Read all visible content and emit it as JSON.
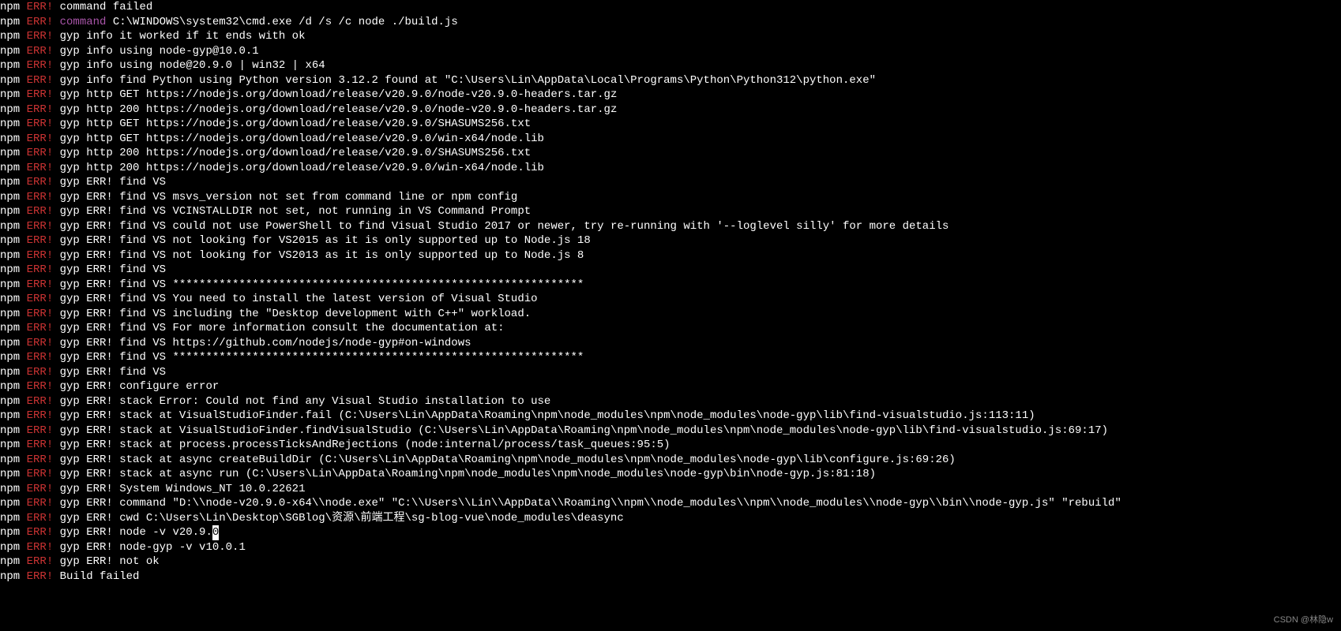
{
  "prefix": "npm",
  "errLabel": "ERR!",
  "commandLabel": "command",
  "lines": [
    {
      "type": "err",
      "text": "command failed"
    },
    {
      "type": "command",
      "text": "C:\\WINDOWS\\system32\\cmd.exe /d /s /c node ./build.js"
    },
    {
      "type": "err",
      "text": "gyp info it worked if it ends with ok"
    },
    {
      "type": "err",
      "text": "gyp info using node-gyp@10.0.1"
    },
    {
      "type": "err",
      "text": "gyp info using node@20.9.0 | win32 | x64"
    },
    {
      "type": "err",
      "text": "gyp info find Python using Python version 3.12.2 found at \"C:\\Users\\Lin\\AppData\\Local\\Programs\\Python\\Python312\\python.exe\""
    },
    {
      "type": "err",
      "text": "gyp http GET https://nodejs.org/download/release/v20.9.0/node-v20.9.0-headers.tar.gz"
    },
    {
      "type": "err",
      "text": "gyp http 200 https://nodejs.org/download/release/v20.9.0/node-v20.9.0-headers.tar.gz"
    },
    {
      "type": "err",
      "text": "gyp http GET https://nodejs.org/download/release/v20.9.0/SHASUMS256.txt"
    },
    {
      "type": "err",
      "text": "gyp http GET https://nodejs.org/download/release/v20.9.0/win-x64/node.lib"
    },
    {
      "type": "err",
      "text": "gyp http 200 https://nodejs.org/download/release/v20.9.0/SHASUMS256.txt"
    },
    {
      "type": "err",
      "text": "gyp http 200 https://nodejs.org/download/release/v20.9.0/win-x64/node.lib"
    },
    {
      "type": "err",
      "text": "gyp ERR! find VS"
    },
    {
      "type": "err",
      "text": "gyp ERR! find VS msvs_version not set from command line or npm config"
    },
    {
      "type": "err",
      "text": "gyp ERR! find VS VCINSTALLDIR not set, not running in VS Command Prompt"
    },
    {
      "type": "err",
      "text": "gyp ERR! find VS could not use PowerShell to find Visual Studio 2017 or newer, try re-running with '--loglevel silly' for more details"
    },
    {
      "type": "err",
      "text": "gyp ERR! find VS not looking for VS2015 as it is only supported up to Node.js 18"
    },
    {
      "type": "err",
      "text": "gyp ERR! find VS not looking for VS2013 as it is only supported up to Node.js 8"
    },
    {
      "type": "err",
      "text": "gyp ERR! find VS"
    },
    {
      "type": "err",
      "text": "gyp ERR! find VS **************************************************************"
    },
    {
      "type": "err",
      "text": "gyp ERR! find VS You need to install the latest version of Visual Studio"
    },
    {
      "type": "err",
      "text": "gyp ERR! find VS including the \"Desktop development with C++\" workload."
    },
    {
      "type": "err",
      "text": "gyp ERR! find VS For more information consult the documentation at:"
    },
    {
      "type": "err",
      "text": "gyp ERR! find VS https://github.com/nodejs/node-gyp#on-windows"
    },
    {
      "type": "err",
      "text": "gyp ERR! find VS **************************************************************"
    },
    {
      "type": "err",
      "text": "gyp ERR! find VS"
    },
    {
      "type": "err",
      "text": "gyp ERR! configure error"
    },
    {
      "type": "err",
      "text": "gyp ERR! stack Error: Could not find any Visual Studio installation to use"
    },
    {
      "type": "err",
      "text": "gyp ERR! stack at VisualStudioFinder.fail (C:\\Users\\Lin\\AppData\\Roaming\\npm\\node_modules\\npm\\node_modules\\node-gyp\\lib\\find-visualstudio.js:113:11)"
    },
    {
      "type": "err",
      "text": "gyp ERR! stack at VisualStudioFinder.findVisualStudio (C:\\Users\\Lin\\AppData\\Roaming\\npm\\node_modules\\npm\\node_modules\\node-gyp\\lib\\find-visualstudio.js:69:17)"
    },
    {
      "type": "err",
      "text": "gyp ERR! stack at process.processTicksAndRejections (node:internal/process/task_queues:95:5)"
    },
    {
      "type": "err",
      "text": "gyp ERR! stack at async createBuildDir (C:\\Users\\Lin\\AppData\\Roaming\\npm\\node_modules\\npm\\node_modules\\node-gyp\\lib\\configure.js:69:26)"
    },
    {
      "type": "err",
      "text": "gyp ERR! stack at async run (C:\\Users\\Lin\\AppData\\Roaming\\npm\\node_modules\\npm\\node_modules\\node-gyp\\bin\\node-gyp.js:81:18)"
    },
    {
      "type": "err",
      "text": "gyp ERR! System Windows_NT 10.0.22621"
    },
    {
      "type": "err",
      "text": "gyp ERR! command \"D:\\\\node-v20.9.0-x64\\\\node.exe\" \"C:\\\\Users\\\\Lin\\\\AppData\\\\Roaming\\\\npm\\\\node_modules\\\\npm\\\\node_modules\\\\node-gyp\\\\bin\\\\node-gyp.js\" \"rebuild\""
    },
    {
      "type": "err",
      "text": "gyp ERR! cwd C:\\Users\\Lin\\Desktop\\SGBlog\\资源\\前端工程\\sg-blog-vue\\node_modules\\deasync"
    },
    {
      "type": "err",
      "text": "gyp ERR! node -v v20.9.",
      "cursor": "0"
    },
    {
      "type": "err",
      "text": "gyp ERR! node-gyp -v v10.0.1"
    },
    {
      "type": "err",
      "text": "gyp ERR! not ok"
    },
    {
      "type": "err",
      "text": "Build failed"
    }
  ],
  "watermark": "CSDN @林隐w"
}
